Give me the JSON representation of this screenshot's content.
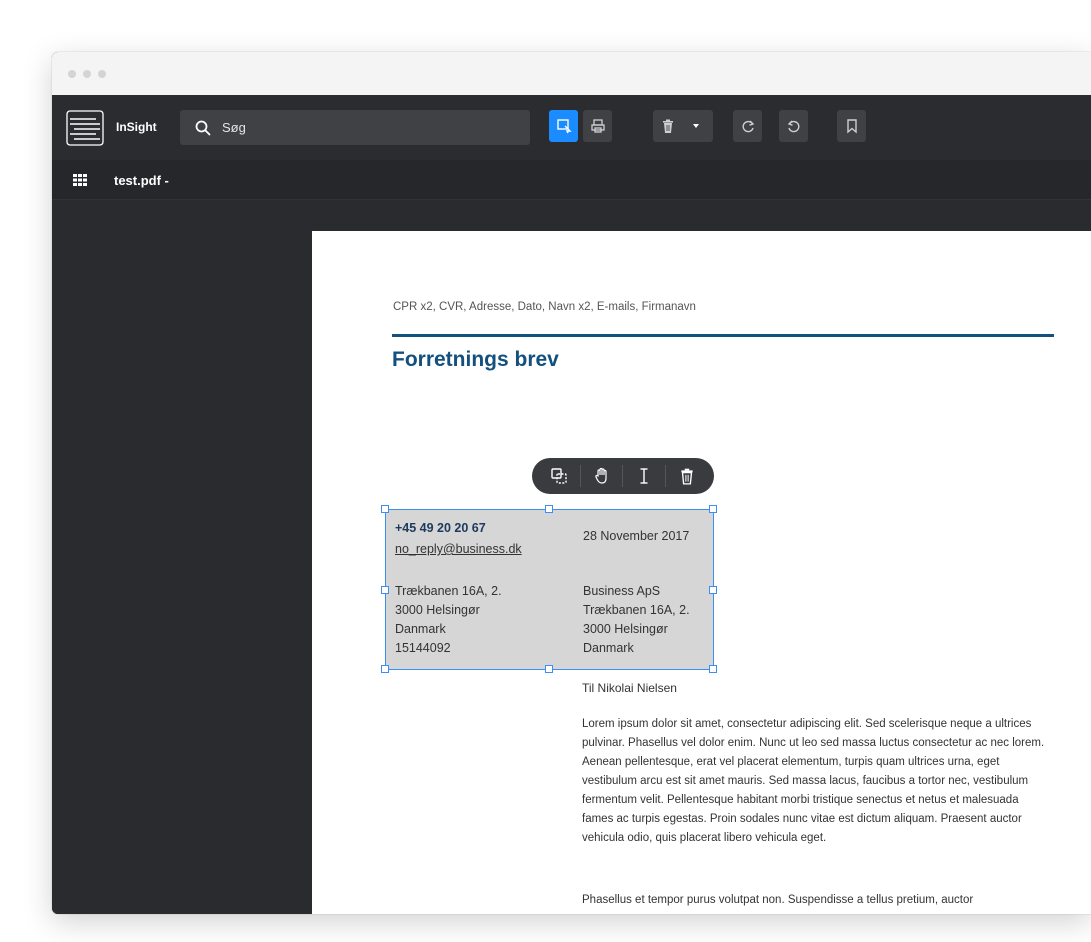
{
  "app": {
    "brand": "InSight"
  },
  "search": {
    "placeholder": "Søg"
  },
  "toolbar": {
    "buttons": [
      {
        "icon": "select-area-icon",
        "active": true
      },
      {
        "icon": "print-icon",
        "active": false
      },
      {
        "icon": "trash-icon",
        "active": false
      },
      {
        "icon": "chevron-down-icon",
        "active": false
      },
      {
        "icon": "redo-icon",
        "active": false
      },
      {
        "icon": "undo-icon",
        "active": false
      },
      {
        "icon": "bookmark-icon",
        "active": false
      }
    ]
  },
  "file": {
    "name": "test.pdf -"
  },
  "document": {
    "meta_line": "CPR x2, CVR, Adresse, Dato, Navn x2, E-mails, Firmanavn",
    "title": "Forretnings brev",
    "sender": {
      "phone": "+45 49 20 20 67",
      "email": "no_reply@business.dk",
      "address": [
        "Trækbanen 16A, 2.",
        "3000 Helsingør",
        "Danmark",
        "15144092"
      ]
    },
    "date": "28 November 2017",
    "recipient": [
      "Business ApS",
      "Trækbanen 16A, 2.",
      "3000 Helsingør",
      "Danmark"
    ],
    "salutation": "Til Nikolai Nielsen",
    "paragraphs": [
      "Lorem ipsum dolor sit amet, consectetur adipiscing elit. Sed scelerisque neque a ultrices pulvinar. Phasellus vel dolor enim. Nunc ut leo sed massa luctus consectetur ac nec lorem. Aenean pellentesque, erat vel placerat elementum, turpis quam ultrices urna, eget vestibulum arcu est sit amet mauris. Sed massa lacus, faucibus a tortor nec, vestibulum fermentum velit. Pellentesque habitant morbi tristique senectus et netus et malesuada fames ac turpis egestas. Proin sodales nunc vitae est dictum aliquam. Praesent auctor vehicula odio, quis placerat libero vehicula eget.",
      "Phasellus et tempor purus volutpat non. Suspendisse a tellus pretium, auctor"
    ]
  },
  "context_menu": {
    "items": [
      "copy-icon",
      "hand-icon",
      "text-cursor-icon",
      "trash-icon"
    ]
  },
  "colors": {
    "accent": "#1a8cff",
    "heading": "#14507e",
    "selection_border": "#3d8ef0"
  }
}
